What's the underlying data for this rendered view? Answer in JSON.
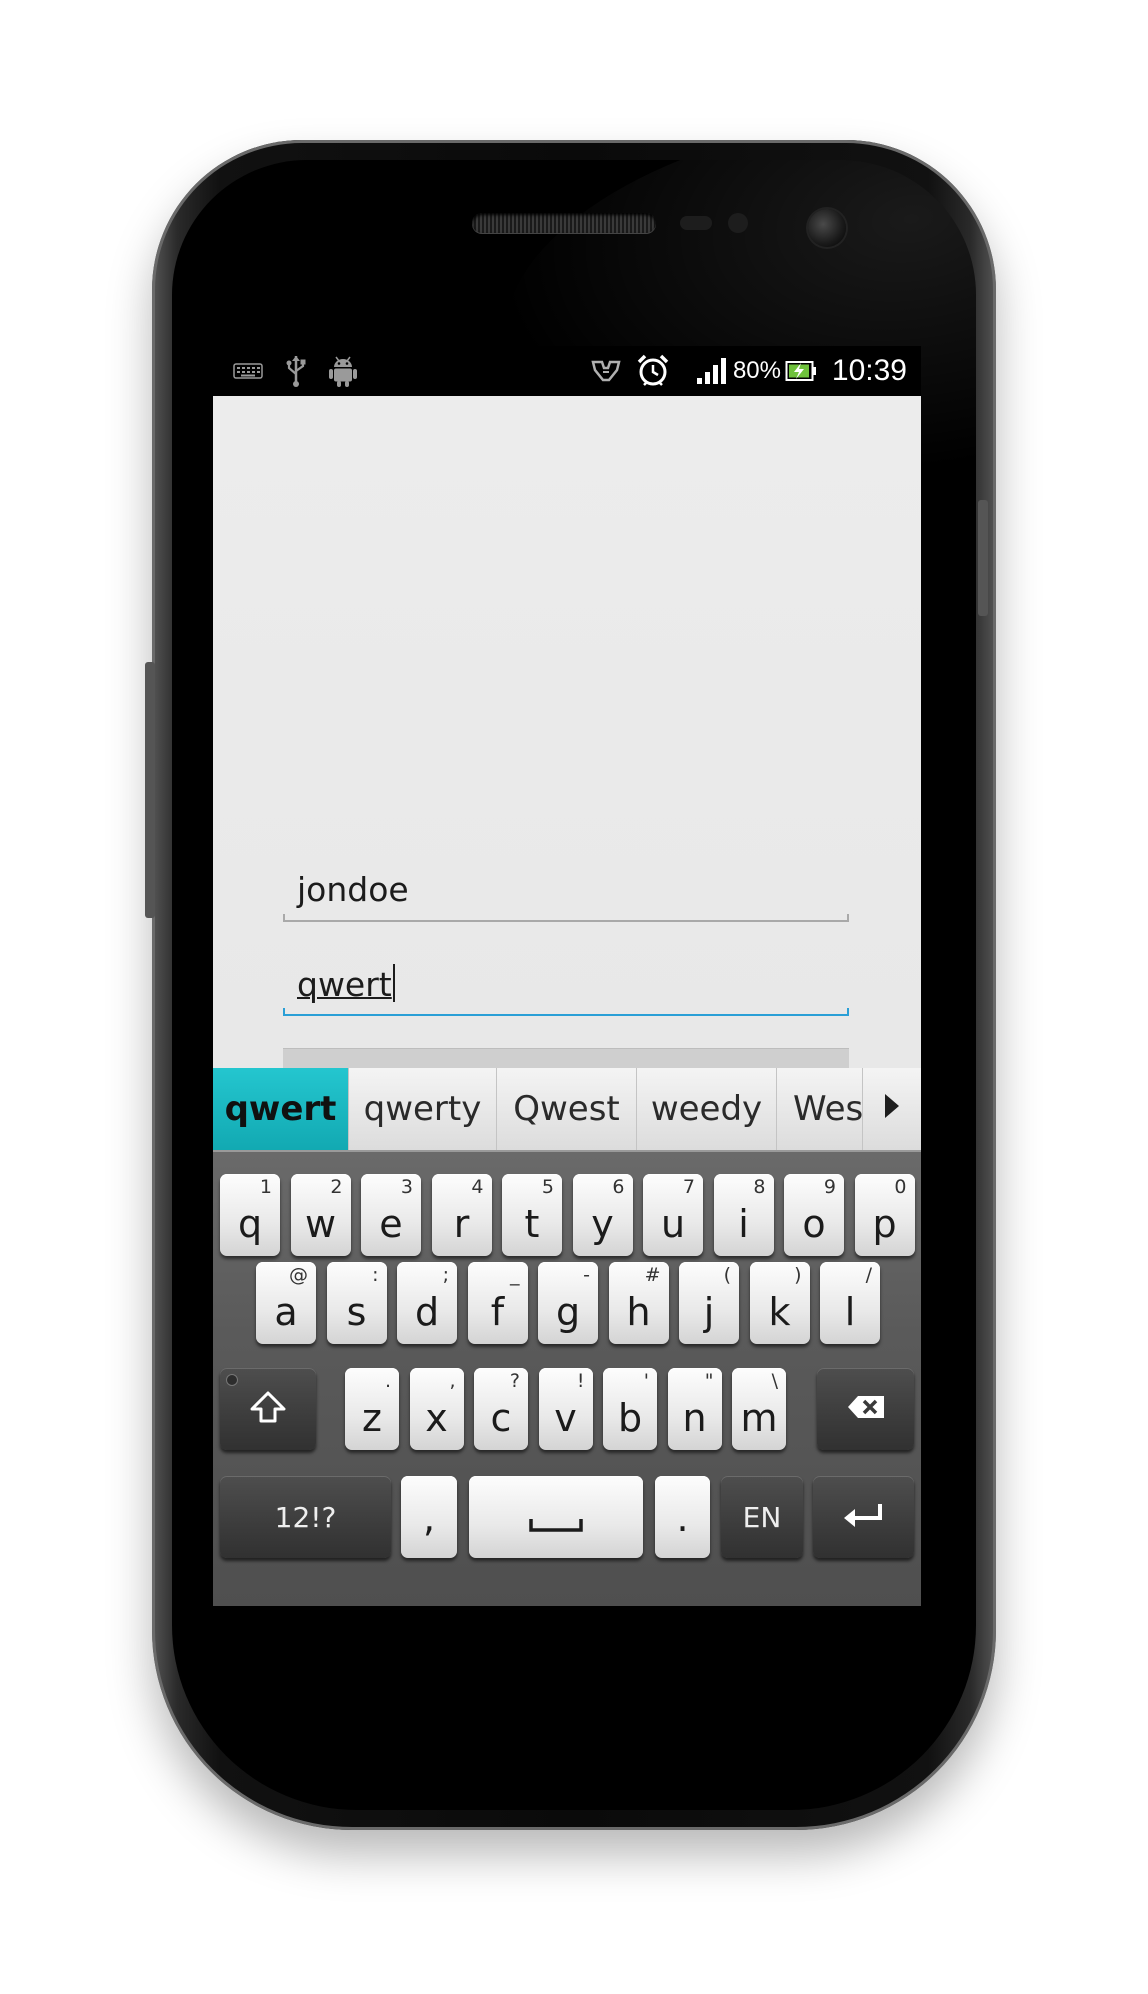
{
  "status_bar": {
    "battery_percent": "80%",
    "time": "10:39",
    "left_icons": [
      "keyboard-icon",
      "usb-icon",
      "android-debug-icon"
    ],
    "right_icons": [
      "network-icon",
      "alarm-icon",
      "signal-icon",
      "battery-charging-icon"
    ]
  },
  "form": {
    "username_value": "jondoe",
    "password_value": "qwert"
  },
  "suggestions": {
    "items": [
      "qwert",
      "qwerty",
      "Qwest",
      "weedy",
      "Wes"
    ],
    "more_icon": "play-arrow-icon"
  },
  "keyboard": {
    "row1": [
      {
        "main": "q",
        "sub": "1"
      },
      {
        "main": "w",
        "sub": "2"
      },
      {
        "main": "e",
        "sub": "3"
      },
      {
        "main": "r",
        "sub": "4"
      },
      {
        "main": "t",
        "sub": "5"
      },
      {
        "main": "y",
        "sub": "6"
      },
      {
        "main": "u",
        "sub": "7"
      },
      {
        "main": "i",
        "sub": "8"
      },
      {
        "main": "o",
        "sub": "9"
      },
      {
        "main": "p",
        "sub": "0"
      }
    ],
    "row2": [
      {
        "main": "a",
        "sub": "@"
      },
      {
        "main": "s",
        "sub": ":"
      },
      {
        "main": "d",
        "sub": ";"
      },
      {
        "main": "f",
        "sub": "_"
      },
      {
        "main": "g",
        "sub": "-"
      },
      {
        "main": "h",
        "sub": "#"
      },
      {
        "main": "j",
        "sub": "("
      },
      {
        "main": "k",
        "sub": ")"
      },
      {
        "main": "l",
        "sub": "/"
      }
    ],
    "row3": [
      {
        "main": "z",
        "sub": "."
      },
      {
        "main": "x",
        "sub": ","
      },
      {
        "main": "c",
        "sub": "?"
      },
      {
        "main": "v",
        "sub": "!"
      },
      {
        "main": "b",
        "sub": "'"
      },
      {
        "main": "n",
        "sub": "\""
      },
      {
        "main": "m",
        "sub": "\\"
      }
    ],
    "symbols_label": "12!?",
    "comma_label": ",",
    "period_label": ".",
    "language_label": "EN",
    "shift_icon": "shift-icon",
    "backspace_icon": "backspace-icon",
    "space_icon": "space-bar-icon",
    "enter_icon": "enter-icon"
  }
}
